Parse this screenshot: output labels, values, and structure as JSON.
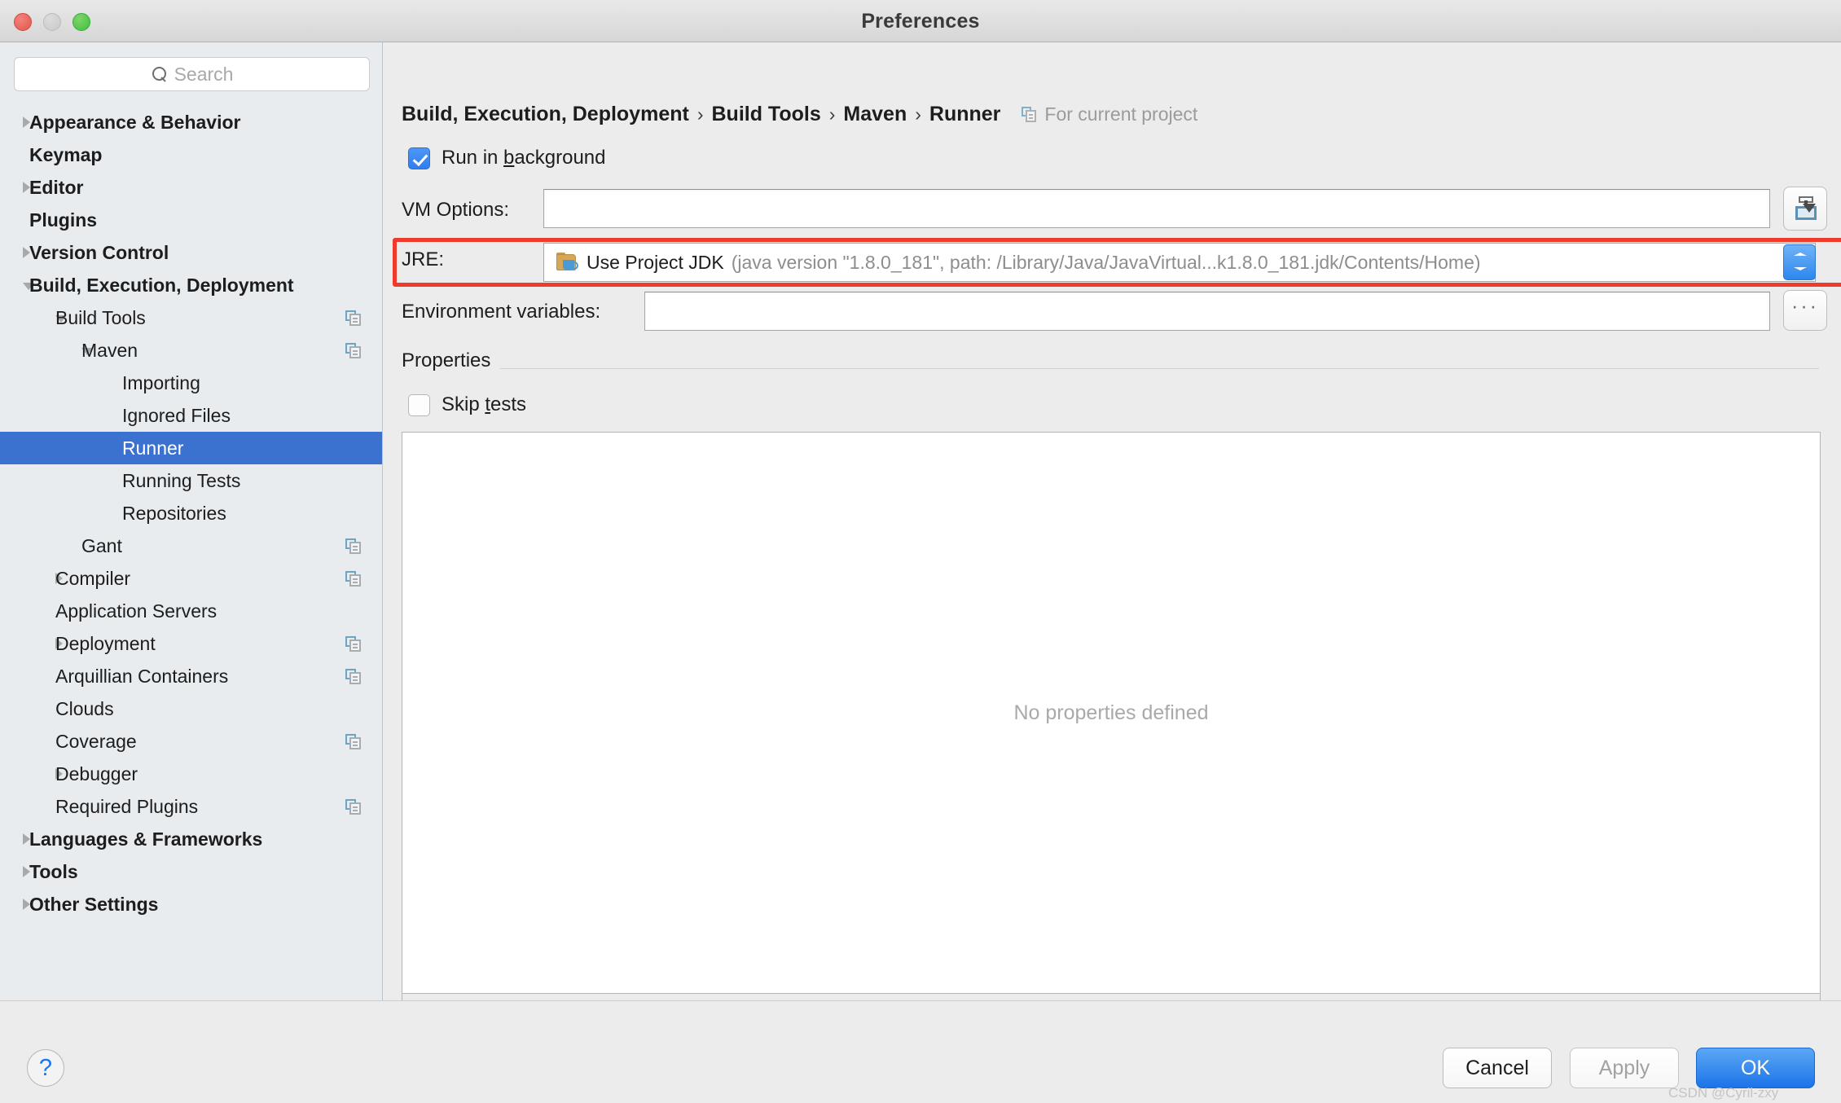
{
  "window": {
    "title": "Preferences",
    "traffic_lights": [
      "close",
      "minimize",
      "zoom"
    ]
  },
  "sidebar": {
    "search": {
      "placeholder": "Search",
      "value": ""
    },
    "items": [
      {
        "label": "Appearance & Behavior",
        "depth": 0,
        "twisty": "right",
        "bold": true,
        "copy_icon": false,
        "selected": false
      },
      {
        "label": "Keymap",
        "depth": 0,
        "twisty": "none",
        "bold": true,
        "copy_icon": false,
        "selected": false
      },
      {
        "label": "Editor",
        "depth": 0,
        "twisty": "right",
        "bold": true,
        "copy_icon": false,
        "selected": false
      },
      {
        "label": "Plugins",
        "depth": 0,
        "twisty": "none",
        "bold": true,
        "copy_icon": false,
        "selected": false
      },
      {
        "label": "Version Control",
        "depth": 0,
        "twisty": "right",
        "bold": true,
        "copy_icon": false,
        "selected": false
      },
      {
        "label": "Build, Execution, Deployment",
        "depth": 0,
        "twisty": "down",
        "bold": true,
        "copy_icon": false,
        "selected": false
      },
      {
        "label": "Build Tools",
        "depth": 1,
        "twisty": "down",
        "bold": false,
        "copy_icon": true,
        "selected": false
      },
      {
        "label": "Maven",
        "depth": 2,
        "twisty": "down",
        "bold": false,
        "copy_icon": true,
        "selected": false
      },
      {
        "label": "Importing",
        "depth": 3,
        "twisty": "none",
        "bold": false,
        "copy_icon": false,
        "selected": false
      },
      {
        "label": "Ignored Files",
        "depth": 3,
        "twisty": "none",
        "bold": false,
        "copy_icon": false,
        "selected": false
      },
      {
        "label": "Runner",
        "depth": 3,
        "twisty": "none",
        "bold": false,
        "copy_icon": false,
        "selected": true
      },
      {
        "label": "Running Tests",
        "depth": 3,
        "twisty": "none",
        "bold": false,
        "copy_icon": false,
        "selected": false
      },
      {
        "label": "Repositories",
        "depth": 3,
        "twisty": "none",
        "bold": false,
        "copy_icon": false,
        "selected": false
      },
      {
        "label": "Gant",
        "depth": 2,
        "twisty": "none",
        "bold": false,
        "copy_icon": true,
        "selected": false
      },
      {
        "label": "Compiler",
        "depth": 1,
        "twisty": "right",
        "bold": false,
        "copy_icon": true,
        "selected": false
      },
      {
        "label": "Application Servers",
        "depth": 1,
        "twisty": "none",
        "bold": false,
        "copy_icon": false,
        "selected": false
      },
      {
        "label": "Deployment",
        "depth": 1,
        "twisty": "right",
        "bold": false,
        "copy_icon": true,
        "selected": false
      },
      {
        "label": "Arquillian Containers",
        "depth": 1,
        "twisty": "none",
        "bold": false,
        "copy_icon": true,
        "selected": false
      },
      {
        "label": "Clouds",
        "depth": 1,
        "twisty": "none",
        "bold": false,
        "copy_icon": false,
        "selected": false
      },
      {
        "label": "Coverage",
        "depth": 1,
        "twisty": "none",
        "bold": false,
        "copy_icon": true,
        "selected": false
      },
      {
        "label": "Debugger",
        "depth": 1,
        "twisty": "right",
        "bold": false,
        "copy_icon": false,
        "selected": false
      },
      {
        "label": "Required Plugins",
        "depth": 1,
        "twisty": "none",
        "bold": false,
        "copy_icon": true,
        "selected": false
      },
      {
        "label": "Languages & Frameworks",
        "depth": 0,
        "twisty": "right",
        "bold": true,
        "copy_icon": false,
        "selected": false
      },
      {
        "label": "Tools",
        "depth": 0,
        "twisty": "right",
        "bold": true,
        "copy_icon": false,
        "selected": false
      },
      {
        "label": "Other Settings",
        "depth": 0,
        "twisty": "right",
        "bold": true,
        "copy_icon": false,
        "selected": false
      }
    ]
  },
  "breadcrumb": {
    "part1": "Build, Execution, Deployment",
    "sep1": "›",
    "part2": "Build Tools",
    "sep2": "›",
    "part3": "Maven",
    "sep3": "›",
    "part4": "Runner",
    "scope_label": "For current project"
  },
  "form": {
    "run_in_background": {
      "label_before": "Run in ",
      "label_mnemonic": "b",
      "label_after": "ackground",
      "checked": true
    },
    "vm_options": {
      "label": "VM Options:",
      "value": "",
      "placeholder": ""
    },
    "jre": {
      "label": "JRE:",
      "selected_name": "Use Project JDK",
      "selected_detail": "(java version \"1.8.0_181\", path: /Library/Java/JavaVirtual...k1.8.0_181.jdk/Contents/Home)",
      "highlight_color": "#ef3b2c"
    },
    "environment_variables": {
      "label": "Environment variables:",
      "value": "",
      "browse_label": "···"
    },
    "properties_section": {
      "title": "Properties"
    },
    "skip_tests": {
      "label_before": "Skip ",
      "label_mnemonic": "t",
      "label_after": "ests",
      "checked": false
    },
    "properties_table": {
      "empty_text": "No properties defined"
    },
    "properties_toolbar": [
      {
        "name": "add",
        "glyph": "+",
        "enabled": true
      },
      {
        "name": "remove",
        "glyph": "−",
        "enabled": false
      },
      {
        "name": "edit",
        "glyph": "✎",
        "enabled": true
      }
    ]
  },
  "footer": {
    "help_label": "?",
    "cancel_label": "Cancel",
    "apply_label": "Apply",
    "apply_enabled": false,
    "ok_label": "OK",
    "watermark": "CSDN @Cyril-zxy"
  },
  "colors": {
    "accent_blue": "#3b72d0",
    "ok_blue": "#1b73e8",
    "highlight_red": "#ef3b2c",
    "sidebar_bg": "#e8ecef",
    "panel_bg": "#ececec"
  }
}
